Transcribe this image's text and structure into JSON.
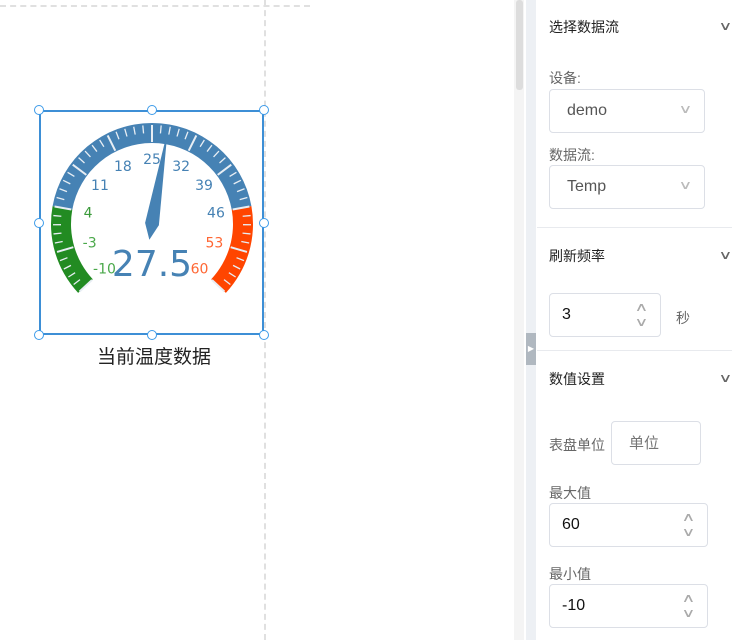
{
  "widget": {
    "caption": "当前温度数据",
    "gauge": {
      "value": 27.5,
      "display": "27.5",
      "min": -10,
      "max": 60,
      "ticks": [
        "-10",
        "-3",
        "4",
        "11",
        "18",
        "25",
        "32",
        "39",
        "46",
        "53",
        "60"
      ],
      "ranges": [
        {
          "from": -10,
          "to": 4,
          "color": "#228b22"
        },
        {
          "from": 4,
          "to": 46,
          "color": "#4682b4"
        },
        {
          "from": 46,
          "to": 60,
          "color": "#ff4500"
        }
      ],
      "needle_color": "#4682b4"
    }
  },
  "panel": {
    "datastream": {
      "title": "选择数据流",
      "device_label": "设备:",
      "device_value": "demo",
      "stream_label": "数据流:",
      "stream_value": "Temp"
    },
    "refresh": {
      "title": "刷新频率",
      "value": "3",
      "unit": "秒"
    },
    "values": {
      "title": "数值设置",
      "unit_label": "表盘单位",
      "unit_placeholder": "单位",
      "max_label": "最大值",
      "max_value": "60",
      "min_label": "最小值",
      "min_value": "-10"
    }
  }
}
